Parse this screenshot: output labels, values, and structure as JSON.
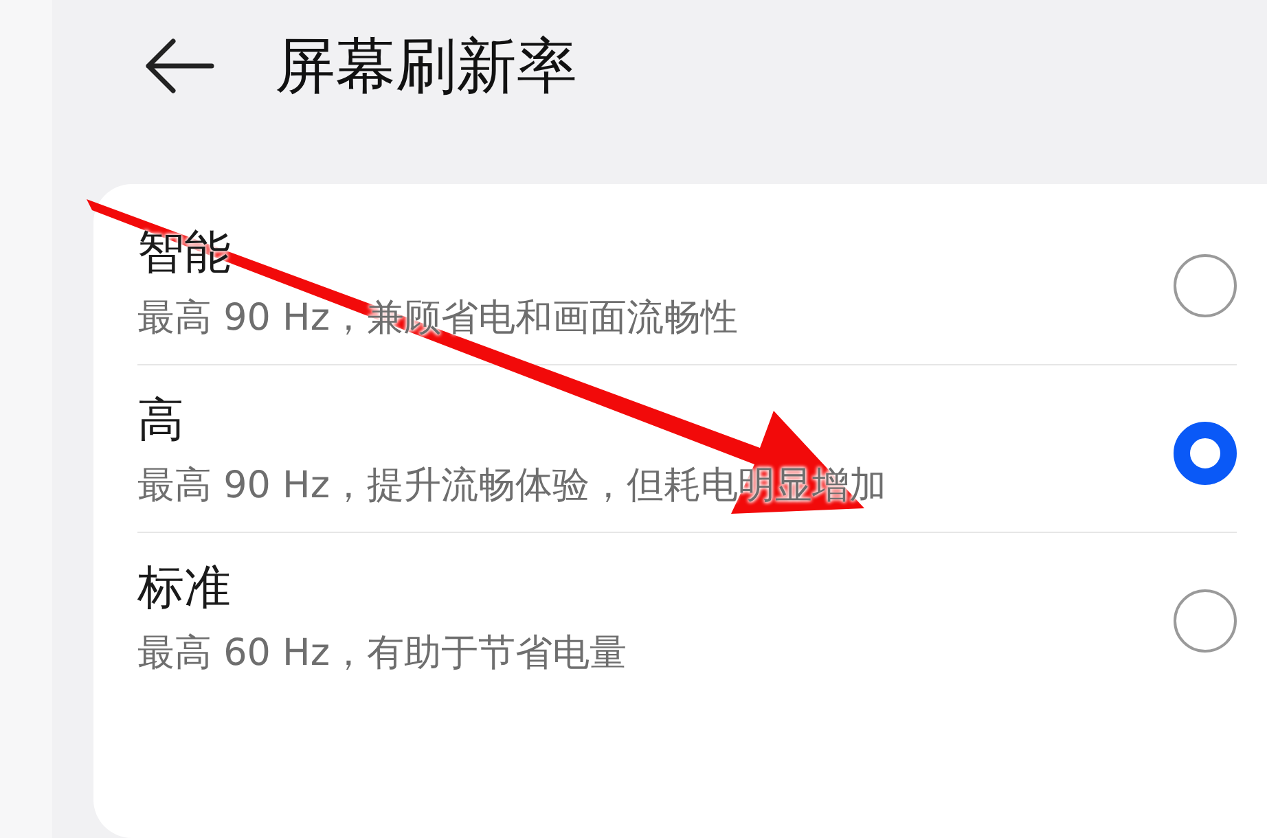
{
  "header": {
    "title": "屏幕刷新率"
  },
  "options": [
    {
      "title": "智能",
      "description": "最高 90 Hz，兼顾省电和画面流畅性",
      "selected": false
    },
    {
      "title": "高",
      "description": "最高 90 Hz，提升流畅体验，但耗电明显增加",
      "selected": true
    },
    {
      "title": "标准",
      "description": "最高 60 Hz，有助于节省电量",
      "selected": false
    }
  ]
}
